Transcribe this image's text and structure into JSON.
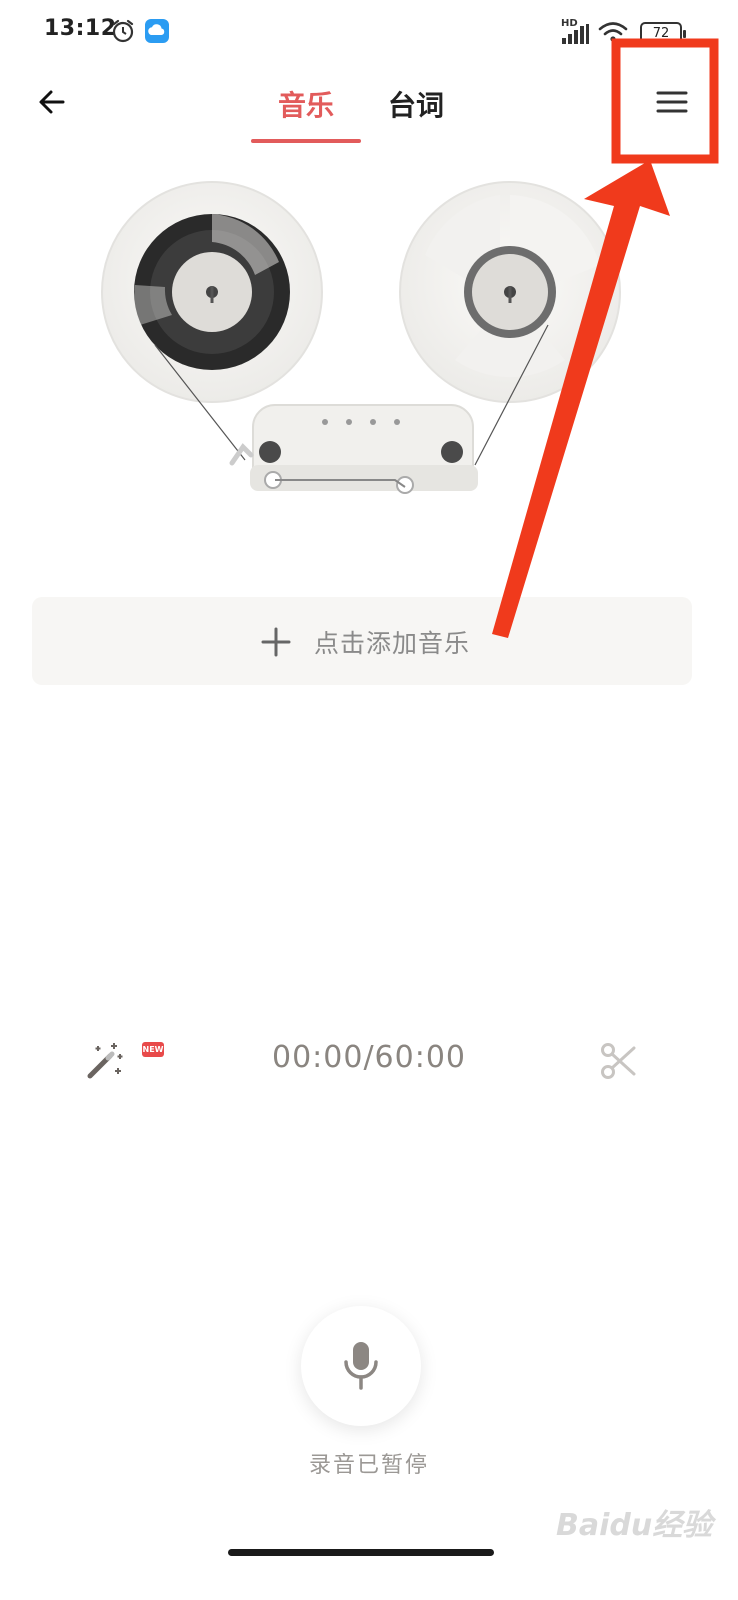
{
  "status_bar": {
    "time": "13:12",
    "network_label": "HD",
    "battery": "72",
    "icons": [
      "alarm-icon",
      "cloud-app-icon",
      "signal-icon",
      "wifi-icon",
      "battery-icon"
    ]
  },
  "header": {
    "back_icon": "arrow-left-icon",
    "tabs": [
      {
        "label": "音乐",
        "active": true
      },
      {
        "label": "台词",
        "active": false
      }
    ],
    "menu_icon": "hamburger-menu-icon"
  },
  "main": {
    "add_music_label": "点击添加音乐",
    "add_icon": "plus-icon"
  },
  "controls": {
    "effects_icon": "magic-wand-icon",
    "new_badge": "NEW",
    "timer": "00:00/60:00",
    "trim_icon": "scissors-icon"
  },
  "record": {
    "mic_icon": "microphone-icon",
    "status": "录音已暂停"
  },
  "watermark": "Baidu经验",
  "colors": {
    "accent": "#e25b5b",
    "annotation_red": "#f03a1c",
    "muted_text": "#8a8580"
  }
}
